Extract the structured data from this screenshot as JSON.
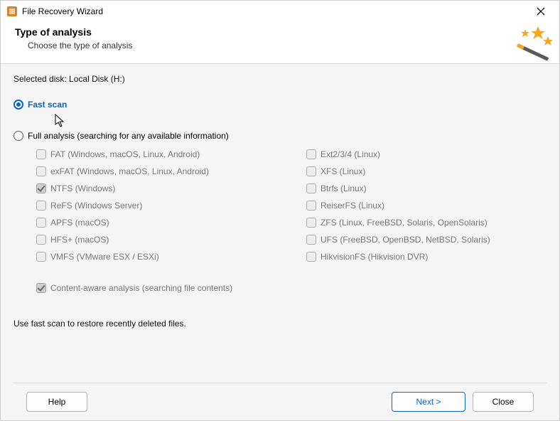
{
  "window": {
    "title": "File Recovery Wizard"
  },
  "header": {
    "title": "Type of analysis",
    "subtitle": "Choose the type of analysis"
  },
  "selected_disk_label": "Selected disk: Local Disk (H:)",
  "options": {
    "fast_scan": {
      "label": "Fast scan",
      "selected": true
    },
    "full_analysis": {
      "label": "Full analysis (searching for any available information)",
      "selected": false
    }
  },
  "filesystems_left": [
    {
      "label": "FAT (Windows, macOS, Linux, Android)",
      "checked": false
    },
    {
      "label": "exFAT (Windows, macOS, Linux, Android)",
      "checked": false
    },
    {
      "label": "NTFS (Windows)",
      "checked": true
    },
    {
      "label": "ReFS (Windows Server)",
      "checked": false
    },
    {
      "label": "APFS (macOS)",
      "checked": false
    },
    {
      "label": "HFS+ (macOS)",
      "checked": false
    },
    {
      "label": "VMFS (VMware ESX / ESXi)",
      "checked": false
    }
  ],
  "filesystems_right": [
    {
      "label": "Ext2/3/4 (Linux)",
      "checked": false
    },
    {
      "label": "XFS (Linux)",
      "checked": false
    },
    {
      "label": "Btrfs (Linux)",
      "checked": false
    },
    {
      "label": "ReiserFS (Linux)",
      "checked": false
    },
    {
      "label": "ZFS (Linux, FreeBSD, Solaris, OpenSolaris)",
      "checked": false
    },
    {
      "label": "UFS (FreeBSD, OpenBSD, NetBSD, Solaris)",
      "checked": false
    },
    {
      "label": "HikvisionFS (Hikvision DVR)",
      "checked": false
    }
  ],
  "content_aware": {
    "label": "Content-aware analysis (searching file contents)",
    "checked": true
  },
  "hint": "Use fast scan to restore recently deleted files.",
  "footer": {
    "help": "Help",
    "next": "Next >",
    "close": "Close"
  }
}
